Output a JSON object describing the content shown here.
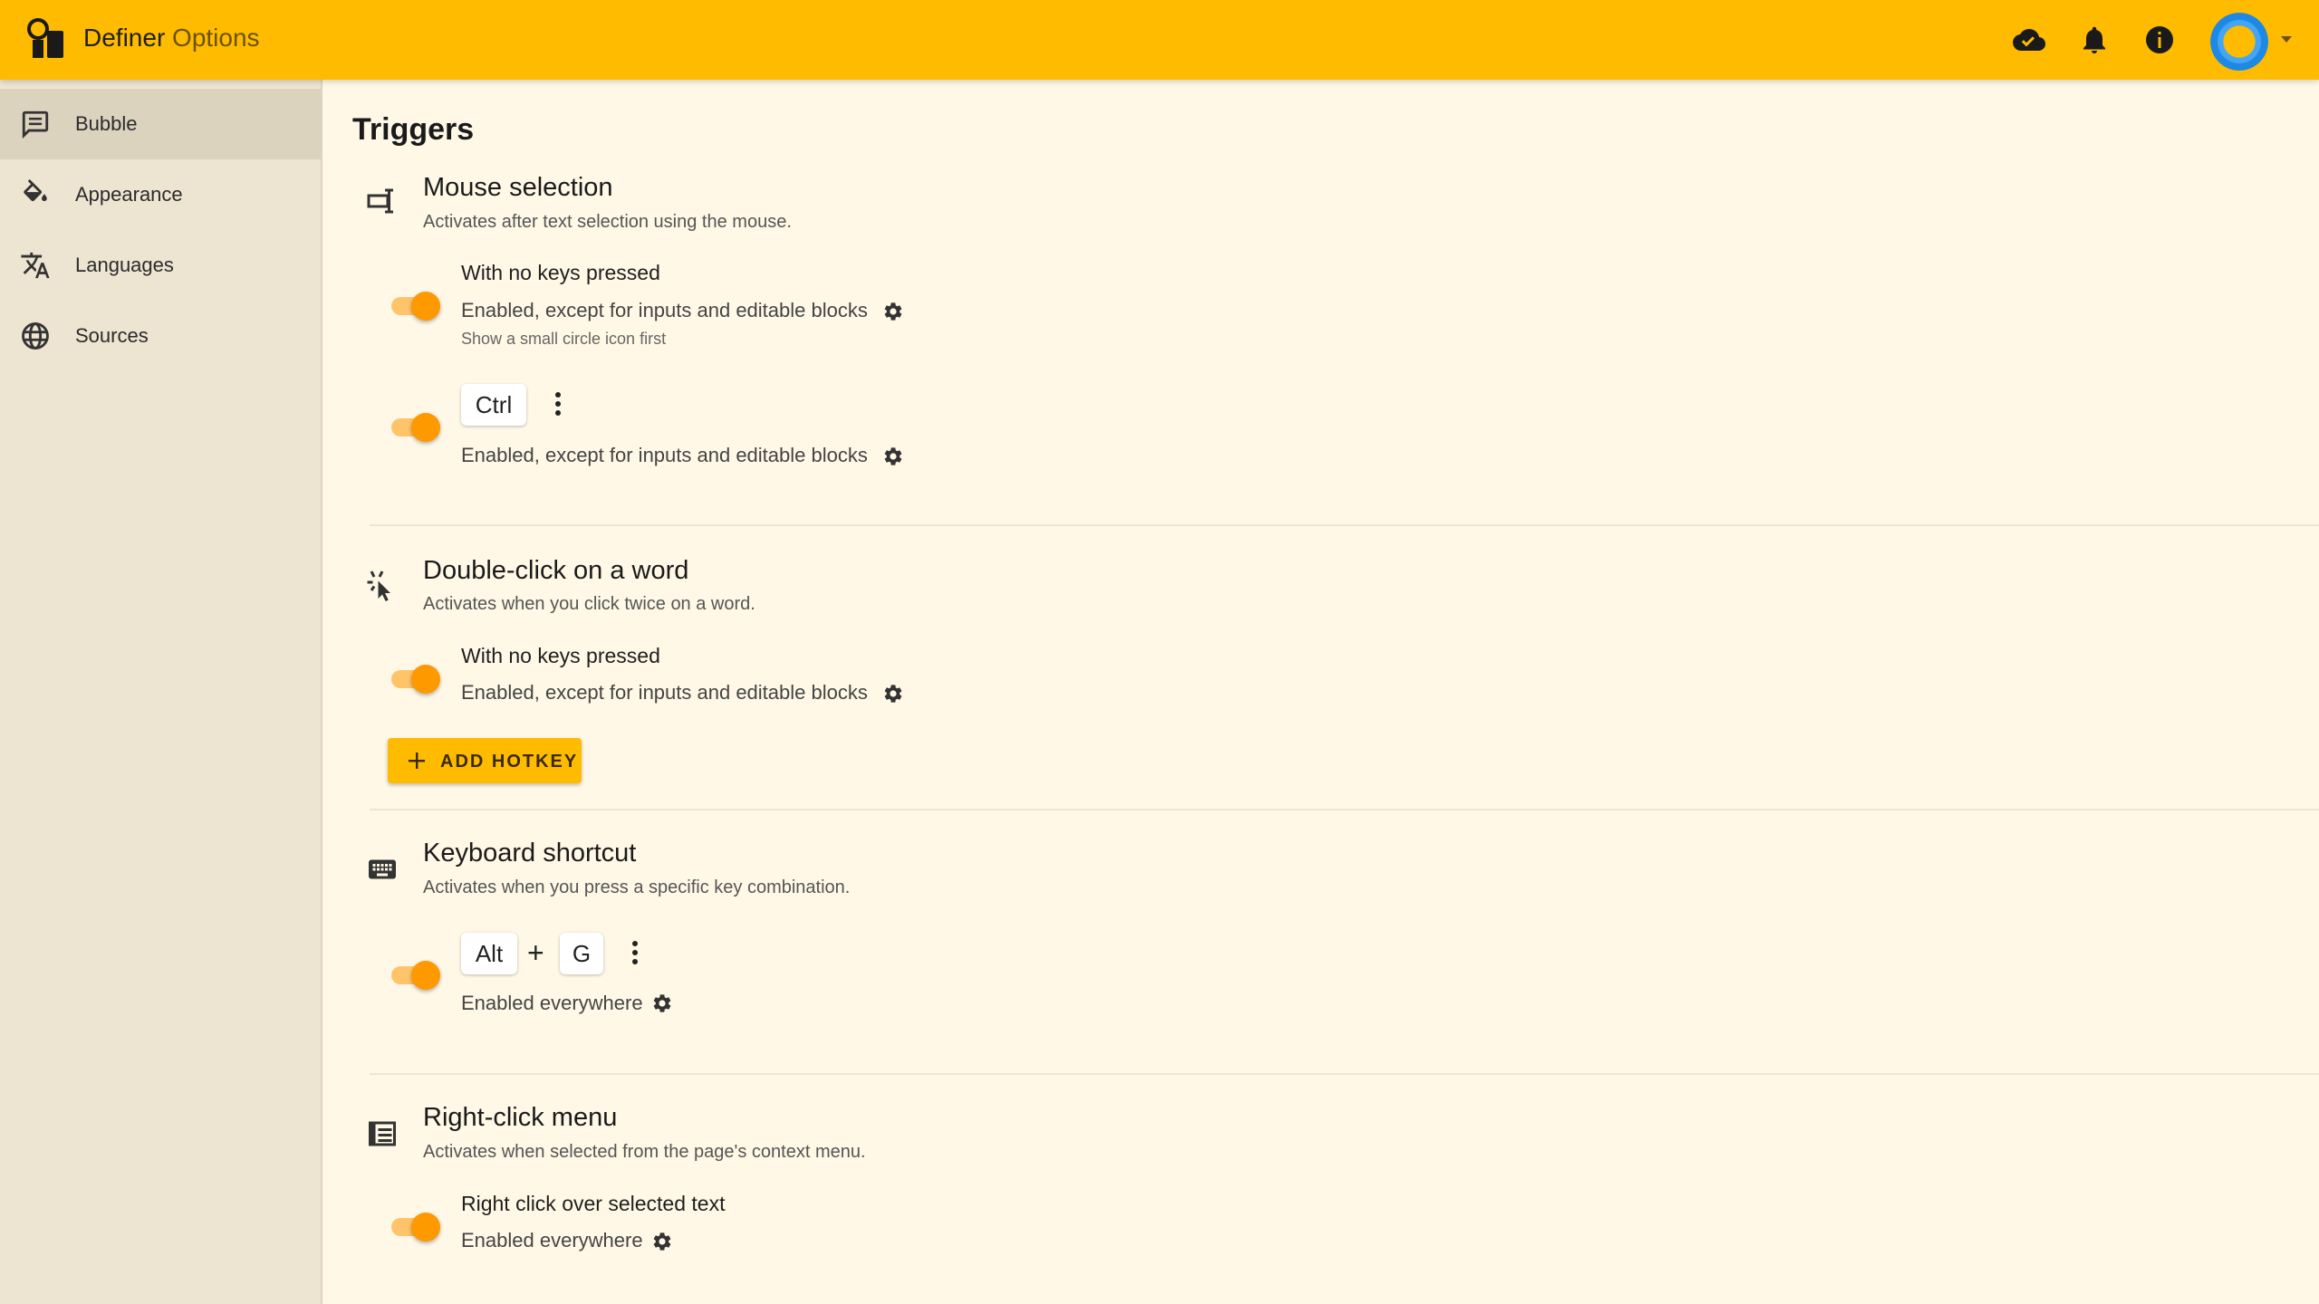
{
  "header": {
    "title": "Definer",
    "title_suffix": "Options",
    "icons": [
      "cloud-done-icon",
      "bell-icon",
      "info-icon",
      "avatar",
      "chevron-down-icon"
    ],
    "accent_color": "#ffbb00"
  },
  "sidebar": {
    "items": [
      {
        "label": "Bubble",
        "icon": "chat-bubble-icon",
        "active": true
      },
      {
        "label": "Appearance",
        "icon": "paint-bucket-icon",
        "active": false
      },
      {
        "label": "Languages",
        "icon": "translate-icon",
        "active": false
      },
      {
        "label": "Sources",
        "icon": "globe-icon",
        "active": false
      }
    ]
  },
  "main": {
    "title": "Triggers",
    "sections": [
      {
        "title": "Mouse selection",
        "description": "Activates after text selection using the mouse.",
        "icon": "text-select-icon",
        "options": [
          {
            "title": "With no keys pressed",
            "subtitle": "Enabled, except for inputs and editable blocks",
            "note": "Show a small circle icon first",
            "enabled": true
          },
          {
            "keys": [
              "Ctrl"
            ],
            "subtitle": "Enabled, except for inputs and editable blocks",
            "enabled": true
          }
        ]
      },
      {
        "title": "Double-click on a word",
        "description": "Activates when you click twice on a word.",
        "icon": "double-click-icon",
        "options": [
          {
            "title": "With no keys pressed",
            "subtitle": "Enabled, except for inputs and editable blocks",
            "enabled": true
          }
        ],
        "add_button": "ADD HOTKEY"
      },
      {
        "title": "Keyboard shortcut",
        "description": "Activates when you press a specific key combination.",
        "icon": "keyboard-icon",
        "options": [
          {
            "keys": [
              "Alt",
              "G"
            ],
            "separator": "+",
            "subtitle": "Enabled everywhere",
            "enabled": true
          }
        ]
      },
      {
        "title": "Right-click menu",
        "description": "Activates when selected from the page's context menu.",
        "icon": "context-menu-icon",
        "options": [
          {
            "title": "Right click over selected text",
            "subtitle": "Enabled everywhere",
            "enabled": true
          }
        ]
      }
    ]
  }
}
